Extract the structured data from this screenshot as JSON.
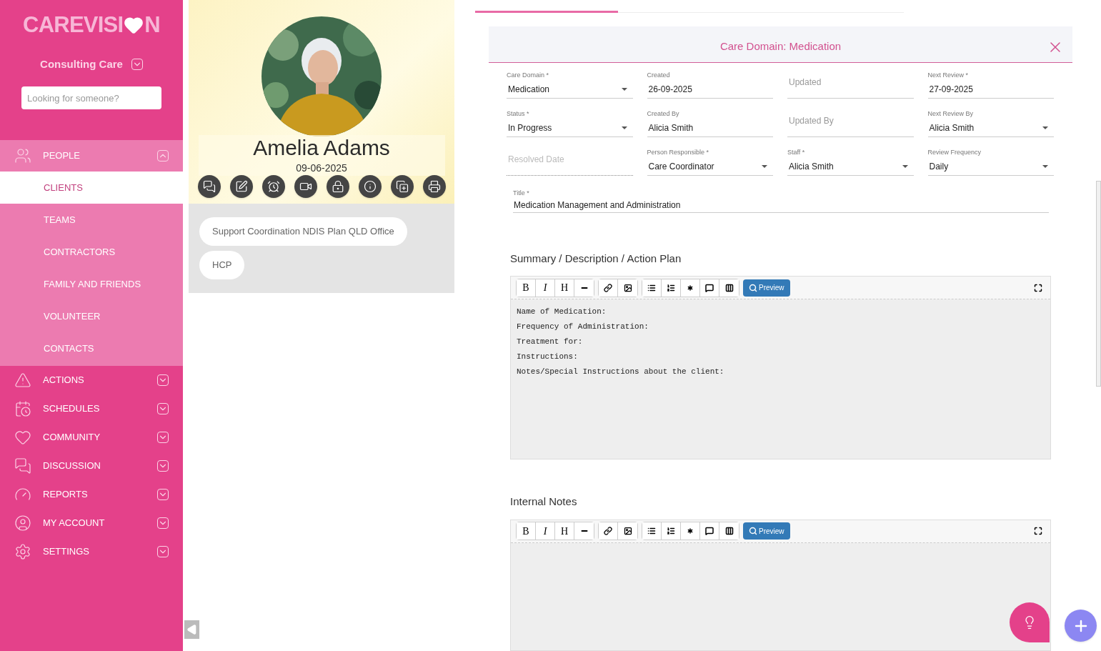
{
  "sidebar": {
    "logo": {
      "before": "CAREVISI",
      "after": "N"
    },
    "organisation": "Consulting Care",
    "search": {
      "placeholder": "Looking for someone?"
    },
    "items": [
      {
        "label": "PEOPLE",
        "expanded": true,
        "children": [
          {
            "label": "CLIENTS",
            "selected": true
          },
          {
            "label": "TEAMS",
            "selected": false
          },
          {
            "label": "CONTRACTORS",
            "selected": false
          },
          {
            "label": "FAMILY AND FRIENDS",
            "selected": false
          },
          {
            "label": "VOLUNTEER",
            "selected": false
          },
          {
            "label": "CONTACTS",
            "selected": false
          }
        ]
      },
      {
        "label": "ACTIONS",
        "expanded": false
      },
      {
        "label": "SCHEDULES",
        "expanded": false
      },
      {
        "label": "COMMUNITY",
        "expanded": false
      },
      {
        "label": "DISCUSSION",
        "expanded": false
      },
      {
        "label": "REPORTS",
        "expanded": false
      },
      {
        "label": "MY ACCOUNT",
        "expanded": false
      },
      {
        "label": "SETTINGS",
        "expanded": false
      }
    ]
  },
  "profile": {
    "name": "Amelia Adams",
    "date": "09-06-2025",
    "photo": {
      "kind": "picture"
    },
    "tags": [
      "Support Coordination NDIS Plan QLD Office",
      "HCP"
    ]
  },
  "tabs": [
    {
      "selected": true
    },
    {
      "selected": false
    },
    {
      "selected": false
    }
  ],
  "panel": {
    "title": "Care Domain: Medication",
    "fields": [
      {
        "label": "Care Domain *",
        "value": "Medication",
        "kind": "select"
      },
      {
        "label": "Created",
        "value": "26-09-2025",
        "kind": "text"
      },
      {
        "placeholder": "Updated",
        "kind": "text"
      },
      {
        "label": "Next Review *",
        "value": "27-09-2025",
        "kind": "text"
      },
      {
        "label": "Status *",
        "value": "In Progress",
        "kind": "select"
      },
      {
        "label": "Created By",
        "value": "Alicia Smith",
        "kind": "text"
      },
      {
        "placeholder": "Updated By",
        "kind": "text"
      },
      {
        "label": "Next Review By",
        "value": "Alicia Smith",
        "kind": "select"
      },
      {
        "placeholder": "Resolved Date",
        "kind": "text",
        "disabled": true
      },
      {
        "label": "Person Responsible *",
        "value": "Care Coordinator",
        "kind": "select"
      },
      {
        "label": "Staff *",
        "value": "Alicia Smith",
        "kind": "select"
      },
      {
        "label": "Review Frequency",
        "value": "Daily",
        "kind": "select"
      }
    ],
    "title_field": {
      "label": "Title *",
      "value": "Medication Management and Administration"
    },
    "editors": [
      {
        "heading": "Summary / Description / Action Plan",
        "toolbar": [
          "B",
          "I",
          "H"
        ],
        "preview": "Preview",
        "lines": [
          "Name of Medication:",
          "Frequency of Administration:",
          "Treatment for:",
          "Instructions:",
          "Notes/Special Instructions about the client:"
        ]
      },
      {
        "heading": "Internal Notes",
        "toolbar": [
          "B",
          "I",
          "H"
        ],
        "preview": "Preview"
      }
    ]
  }
}
